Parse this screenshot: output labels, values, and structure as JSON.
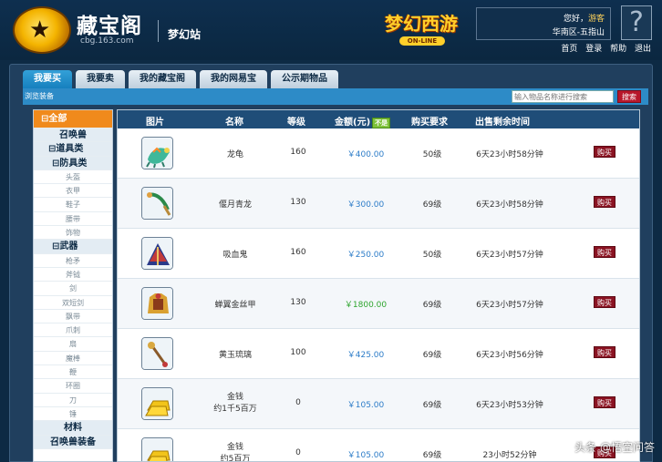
{
  "header": {
    "logo_title": "藏宝阁",
    "logo_domain": "cbg.163.com",
    "site_name": "梦幻站",
    "game_logo_main": "梦幻西游",
    "game_logo_sub": "ON-LINE",
    "greeting": "您好，",
    "guest_name": "游客",
    "server": "华南区-五指山",
    "help_glyph": "?",
    "top_links": [
      "首页",
      "登录",
      "帮助",
      "退出"
    ]
  },
  "tabs": [
    "我要买",
    "我要卖",
    "我的藏宝阁",
    "我的网易宝",
    "公示期物品"
  ],
  "active_tab": 0,
  "subbar": {
    "label": "浏览装备",
    "search_placeholder": "输入物品名称进行搜索",
    "search_button": "搜索"
  },
  "sidebar": {
    "items": [
      {
        "label": "⊟全部",
        "type": "all"
      },
      {
        "label": "召唤兽",
        "type": "cat"
      },
      {
        "label": "⊟道具类",
        "type": "cat-left"
      },
      {
        "label": "⊟防具类",
        "type": "cat-left2"
      },
      {
        "label": "头盔",
        "type": "sub"
      },
      {
        "label": "衣甲",
        "type": "sub"
      },
      {
        "label": "鞋子",
        "type": "sub"
      },
      {
        "label": "腰带",
        "type": "sub"
      },
      {
        "label": "饰物",
        "type": "sub"
      },
      {
        "label": "⊟武器",
        "type": "cat-left2"
      },
      {
        "label": "枪矛",
        "type": "sub"
      },
      {
        "label": "斧钺",
        "type": "sub"
      },
      {
        "label": "剑",
        "type": "sub"
      },
      {
        "label": "双短剑",
        "type": "sub"
      },
      {
        "label": "飘带",
        "type": "sub"
      },
      {
        "label": "爪刺",
        "type": "sub"
      },
      {
        "label": "扇",
        "type": "sub"
      },
      {
        "label": "魔棒",
        "type": "sub"
      },
      {
        "label": "鞭",
        "type": "sub"
      },
      {
        "label": "环圈",
        "type": "sub"
      },
      {
        "label": "刀",
        "type": "sub"
      },
      {
        "label": "锤",
        "type": "sub"
      },
      {
        "label": "材料",
        "type": "cat"
      },
      {
        "label": "召唤兽装备",
        "type": "cat"
      }
    ]
  },
  "table": {
    "headers": {
      "image": "图片",
      "name": "名称",
      "level": "等级",
      "price": "金额(元)",
      "price_tag": "不是",
      "requirement": "购买要求",
      "time_left": "出售剩余时间"
    },
    "buy_label": "购买",
    "rows": [
      {
        "icon": "dragon-tortoise-icon",
        "name_line1": "龙龟",
        "name_line2": "",
        "level": "160",
        "price": "￥400.00",
        "price_color": "blue",
        "requirement": "50级",
        "time": "6天23小时58分钟"
      },
      {
        "icon": "jade-dragon-blade-icon",
        "name_line1": "偃月青龙",
        "name_line2": "",
        "level": "130",
        "price": "￥300.00",
        "price_color": "blue",
        "requirement": "69级",
        "time": "6天23小时58分钟"
      },
      {
        "icon": "vampire-fan-icon",
        "name_line1": "吸血鬼",
        "name_line2": "",
        "level": "160",
        "price": "￥250.00",
        "price_color": "blue",
        "requirement": "50级",
        "time": "6天23小时57分钟"
      },
      {
        "icon": "golden-armor-icon",
        "name_line1": "蝉翼金丝甲",
        "name_line2": "",
        "level": "130",
        "price": "￥1800.00",
        "price_color": "green",
        "requirement": "69级",
        "time": "6天23小时57分钟"
      },
      {
        "icon": "jade-scepter-icon",
        "name_line1": "黄玉琉璃",
        "name_line2": "",
        "level": "100",
        "price": "￥425.00",
        "price_color": "blue",
        "requirement": "69级",
        "time": "6天23小时56分钟"
      },
      {
        "icon": "gold-ingot-icon",
        "name_line1": "金钱",
        "name_line2": "约1千5百万",
        "level": "0",
        "price": "￥105.00",
        "price_color": "blue",
        "requirement": "69级",
        "time": "6天23小时53分钟"
      },
      {
        "icon": "gold-ingot-icon",
        "name_line1": "金钱",
        "name_line2": "约5百万",
        "level": "0",
        "price": "￥105.00",
        "price_color": "blue",
        "requirement": "69级",
        "time": "23小时52分钟"
      }
    ]
  },
  "watermark": "头条 @悟空问答",
  "colors": {
    "page_bg": "#0d2a44",
    "active_tab": "#1f8ccc",
    "sidebar_all": "#f08a1c",
    "buy_button": "#8b1322",
    "price_blue": "#2c7cc8",
    "price_green": "#2ea52e"
  }
}
